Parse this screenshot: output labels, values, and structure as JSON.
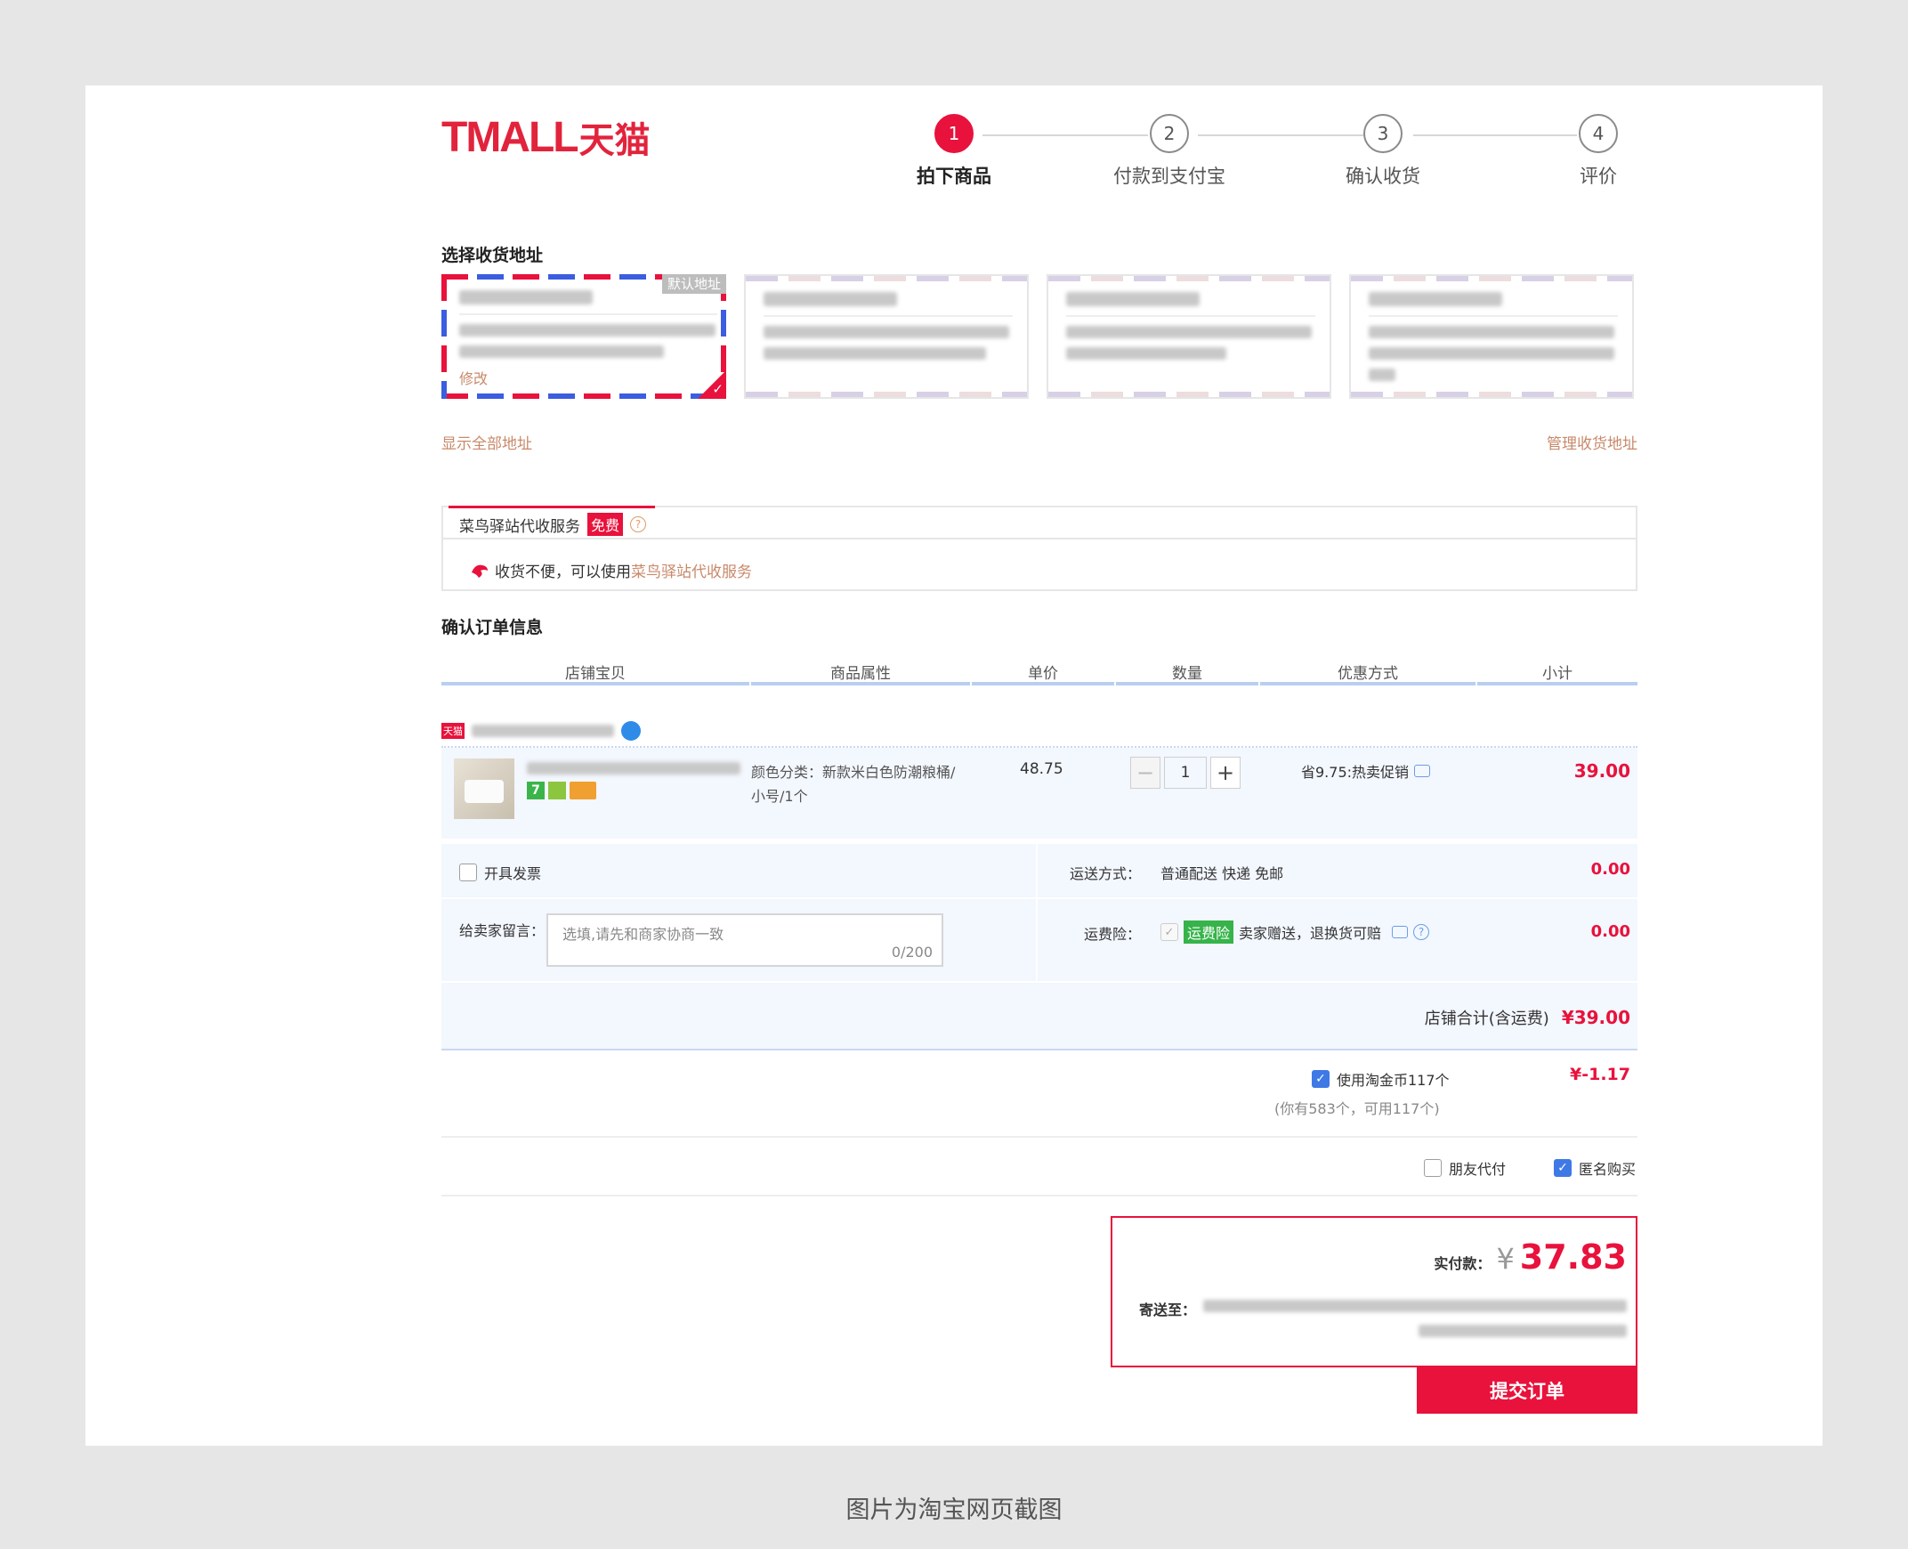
{
  "logo": {
    "en": "TMALL",
    "cn": "天猫"
  },
  "steps": [
    {
      "num": "1",
      "label": "拍下商品"
    },
    {
      "num": "2",
      "label": "付款到支付宝"
    },
    {
      "num": "3",
      "label": "确认收货"
    },
    {
      "num": "4",
      "label": "评价"
    }
  ],
  "address": {
    "section_title": "选择收货地址",
    "default_tag": "默认地址",
    "edit_label": "修改",
    "show_all": "显示全部地址",
    "manage": "管理收货地址"
  },
  "cainiao": {
    "tab_label": "菜鸟驿站代收服务",
    "free_badge": "免费",
    "hint_prefix": "收货不便，可以使用",
    "hint_link": "菜鸟驿站代收服务"
  },
  "order": {
    "section_title": "确认订单信息",
    "columns": [
      "店铺宝贝",
      "商品属性",
      "单价",
      "数量",
      "优惠方式",
      "小计"
    ],
    "shop_badge": "天猫",
    "item": {
      "attr_line1": "颜色分类：新款米白色防潮粮桶/",
      "attr_line2": "小号/1个",
      "unit_price": "48.75",
      "quantity": "1",
      "discount": "省9.75:热卖促销",
      "subtotal": "39.00"
    },
    "invoice_label": "开具发票",
    "shipping_label": "运送方式：",
    "shipping_value": "普通配送 快递 免邮",
    "shipping_fee": "0.00",
    "message_label": "给卖家留言：",
    "message_placeholder": "选填,请先和商家协商一致",
    "message_count": "0/200",
    "insurance_label": "运费险：",
    "insurance_tag": "运费险",
    "insurance_desc": "卖家赠送，退换货可赔",
    "insurance_fee": "0.00",
    "shop_total_label": "店铺合计(含运费)",
    "shop_total_value": "¥39.00",
    "coin_label": "使用淘金币117个",
    "coin_value": "¥-1.17",
    "coin_note": "(你有583个，可用117个)",
    "friend_pay": "朋友代付",
    "anonymous": "匿名购买"
  },
  "payment": {
    "paid_label": "实付款：",
    "currency": "¥",
    "amount": "37.83",
    "ship_to_label": "寄送至："
  },
  "submit_label": "提交订单",
  "caption": "图片为淘宝网页截图",
  "colors": {
    "brand_red": "#e8123c",
    "link_tan": "#c8896a",
    "header_blue": "#b8cff0",
    "row_bg": "#f3f7fe"
  }
}
